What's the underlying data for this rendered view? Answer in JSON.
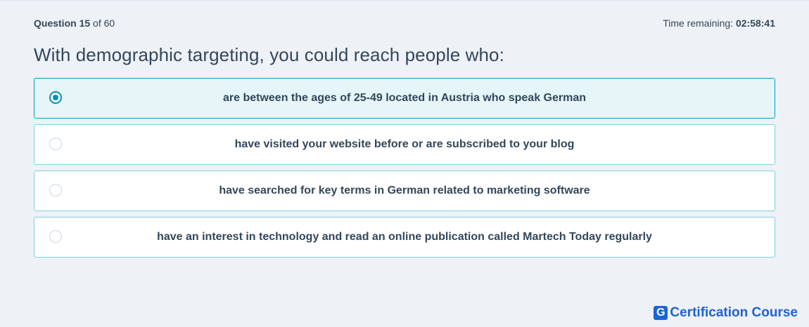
{
  "header": {
    "question_prefix": "Question",
    "question_number": "15",
    "question_of": "of 60",
    "time_label": "Time remaining:",
    "time_value": "02:58:41"
  },
  "question": {
    "text": "With demographic targeting, you could reach people who:"
  },
  "options": [
    {
      "label": "are between the ages of 25-49 located in Austria who speak German",
      "selected": true
    },
    {
      "label": "have visited your website before or are subscribed to your blog",
      "selected": false
    },
    {
      "label": "have searched for key terms in German related to marketing software",
      "selected": false
    },
    {
      "label": "have an interest in technology and read an online publication called Martech Today regularly",
      "selected": false
    }
  ],
  "brand": {
    "badge": "G",
    "name": "Certification Course",
    "color": "#1d63d6"
  },
  "colors": {
    "accent": "#0091ae",
    "selected_bg": "#e5f5f8",
    "text": "#33475b",
    "page_bg": "#eef1f6"
  }
}
